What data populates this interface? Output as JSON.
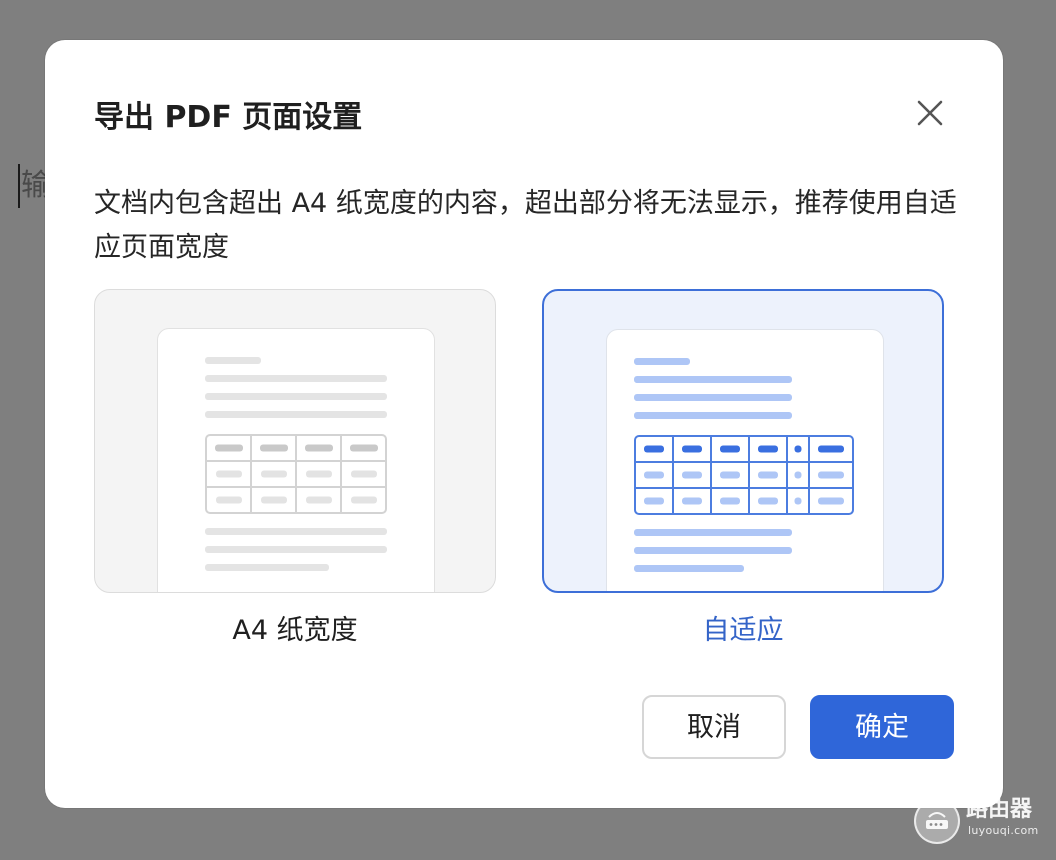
{
  "background": {
    "editor_text": "输",
    "overlay_color": "#7f7f7f"
  },
  "dialog": {
    "title": "导出 PDF 页面设置",
    "close_icon": "close-icon",
    "message": "文档内包含超出 A4 纸宽度的内容，超出部分将无法显示，推荐使用自适应页面宽度",
    "options": [
      {
        "label": "A4 纸宽度",
        "selected": false
      },
      {
        "label": "自适应",
        "selected": true
      }
    ],
    "buttons": {
      "cancel": "取消",
      "confirm": "确定"
    },
    "colors": {
      "accent": "#2f66d9",
      "selected_label": "#3464c8",
      "selected_card_bg": "#edf2fc"
    }
  },
  "watermark": {
    "title": "路由器",
    "url": "luyouqi.com"
  }
}
